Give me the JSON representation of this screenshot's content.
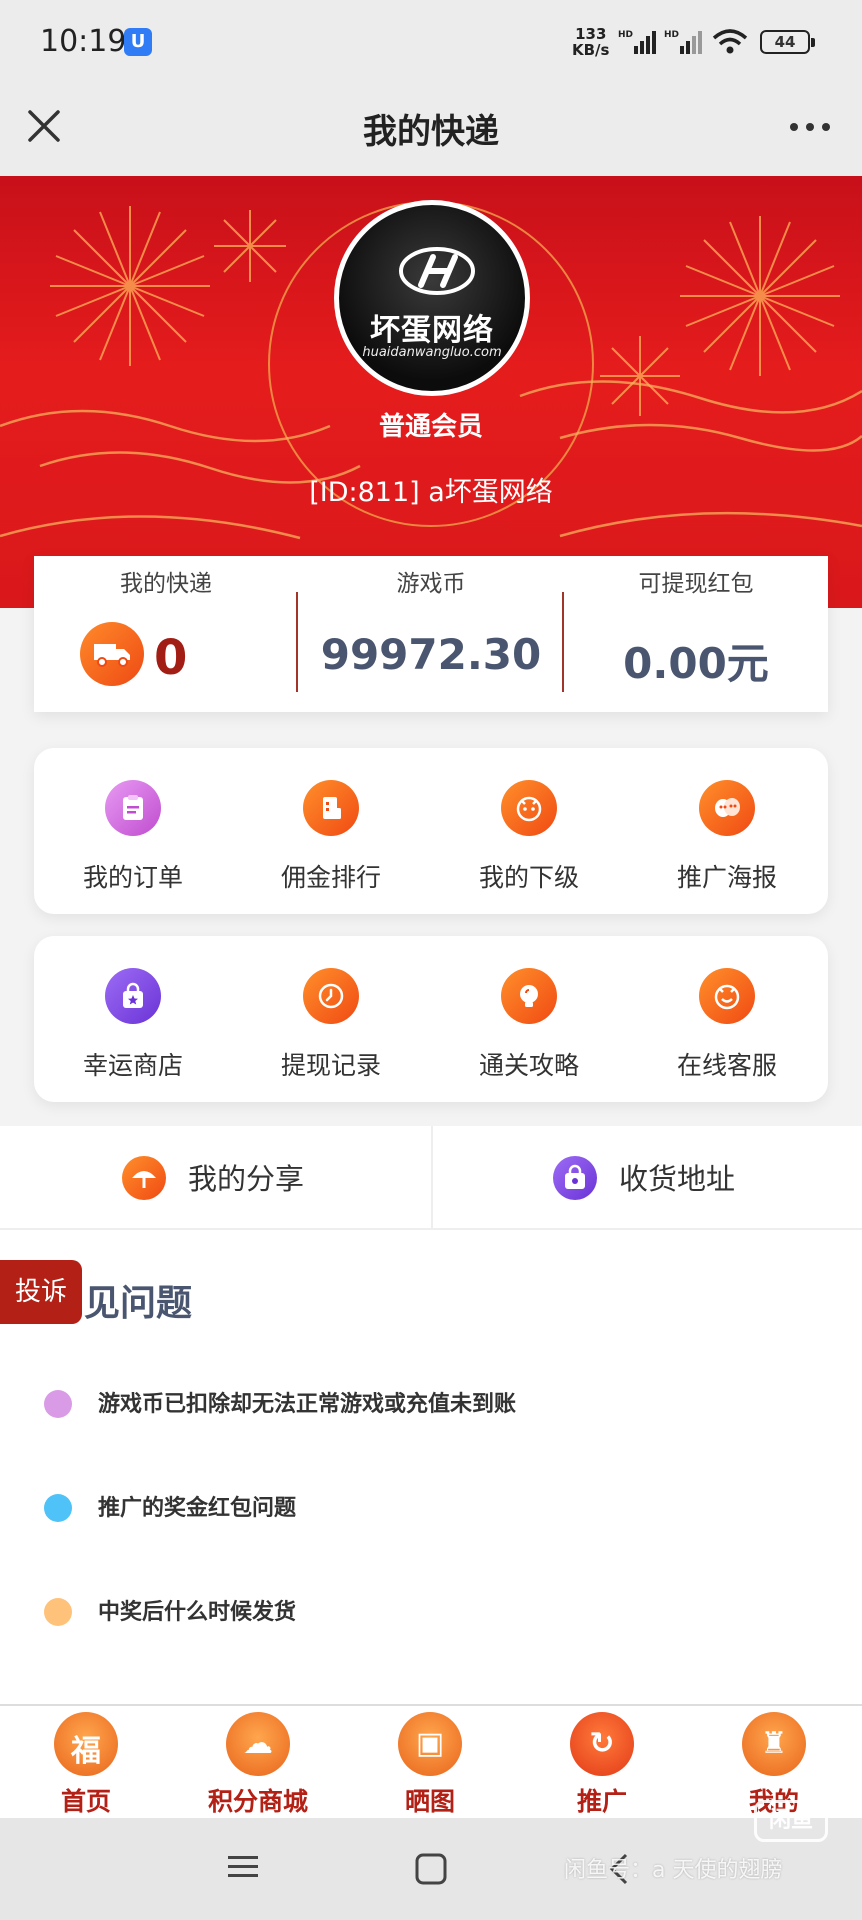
{
  "status_bar": {
    "time": "10:19",
    "app_badge": "U",
    "speed_value": "133",
    "speed_unit": "KB/s",
    "battery": "44"
  },
  "title_bar": {
    "title": "我的快递"
  },
  "profile": {
    "logo_text": "坏蛋网络",
    "logo_sub": "huaidanwangluo.com",
    "member_level": "普通会员",
    "member_id": "[ID:811]  a坏蛋网络"
  },
  "stats": {
    "express_label": "我的快递",
    "express_value": "0",
    "coins_label": "游戏币",
    "coins_value": "99972.30",
    "redpack_label": "可提现红包",
    "redpack_value": "0.00元"
  },
  "grid_row_1": [
    {
      "label": "我的订单",
      "icon": "clipboard-icon"
    },
    {
      "label": "佣金排行",
      "icon": "ranking-icon"
    },
    {
      "label": "我的下级",
      "icon": "face-icon"
    },
    {
      "label": "推广海报",
      "icon": "mask-icon"
    }
  ],
  "grid_row_2": [
    {
      "label": "幸运商店",
      "icon": "shopping-bag-icon"
    },
    {
      "label": "提现记录",
      "icon": "clock-icon"
    },
    {
      "label": "通关攻略",
      "icon": "lightbulb-icon"
    },
    {
      "label": "在线客服",
      "icon": "chat-face-icon"
    }
  ],
  "links": {
    "share_label": "我的分享",
    "address_label": "收货地址"
  },
  "faq": {
    "complain_label": "投诉",
    "title_visible": "见问题",
    "items": [
      {
        "text": "游戏币已扣除却无法正常游戏或充值未到账",
        "color": "#d99be6"
      },
      {
        "text": "推广的奖金红包问题",
        "color": "#4fc3f7"
      },
      {
        "text": "中奖后什么时候发货",
        "color": "#ffc27a"
      }
    ]
  },
  "tab_bar": [
    {
      "label": "首页",
      "glyph": "福"
    },
    {
      "label": "积分商城",
      "glyph": "☁"
    },
    {
      "label": "晒图",
      "glyph": "▣"
    },
    {
      "label": "推广",
      "glyph": "↻"
    },
    {
      "label": "我的",
      "glyph": "♜"
    }
  ],
  "watermark": {
    "text": "闲鱼号：a 天使的翅膀",
    "badge": "闲鱼"
  },
  "colors": {
    "banner_red": "#e51c1c",
    "accent_orange": "#f04a13",
    "complain_red": "#b32015",
    "value_slate": "#4a5670"
  }
}
